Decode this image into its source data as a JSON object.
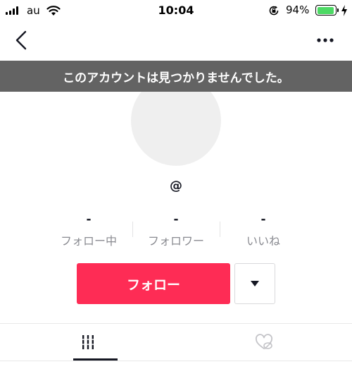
{
  "status_bar": {
    "carrier": "au",
    "time": "10:04",
    "battery_percent": "94%",
    "battery_level": 0.94,
    "battery_color": "#4cd964"
  },
  "nav": {
    "back_icon": "chevron-left-icon",
    "more_icon": "ellipsis-icon"
  },
  "banner": {
    "message": "このアカウントは見つかりませんでした。",
    "background": "#636363"
  },
  "profile": {
    "username": "@",
    "stats": [
      {
        "value": "-",
        "label": "フォロー中"
      },
      {
        "value": "-",
        "label": "フォロワー"
      },
      {
        "value": "-",
        "label": "いいね"
      }
    ]
  },
  "actions": {
    "follow_label": "フォロー",
    "follow_color": "#fe2c55",
    "dropdown_icon": "triangle-down-icon"
  },
  "tabs": [
    {
      "icon": "grid-icon",
      "selected": true
    },
    {
      "icon": "heart-hidden-icon",
      "selected": false
    }
  ]
}
